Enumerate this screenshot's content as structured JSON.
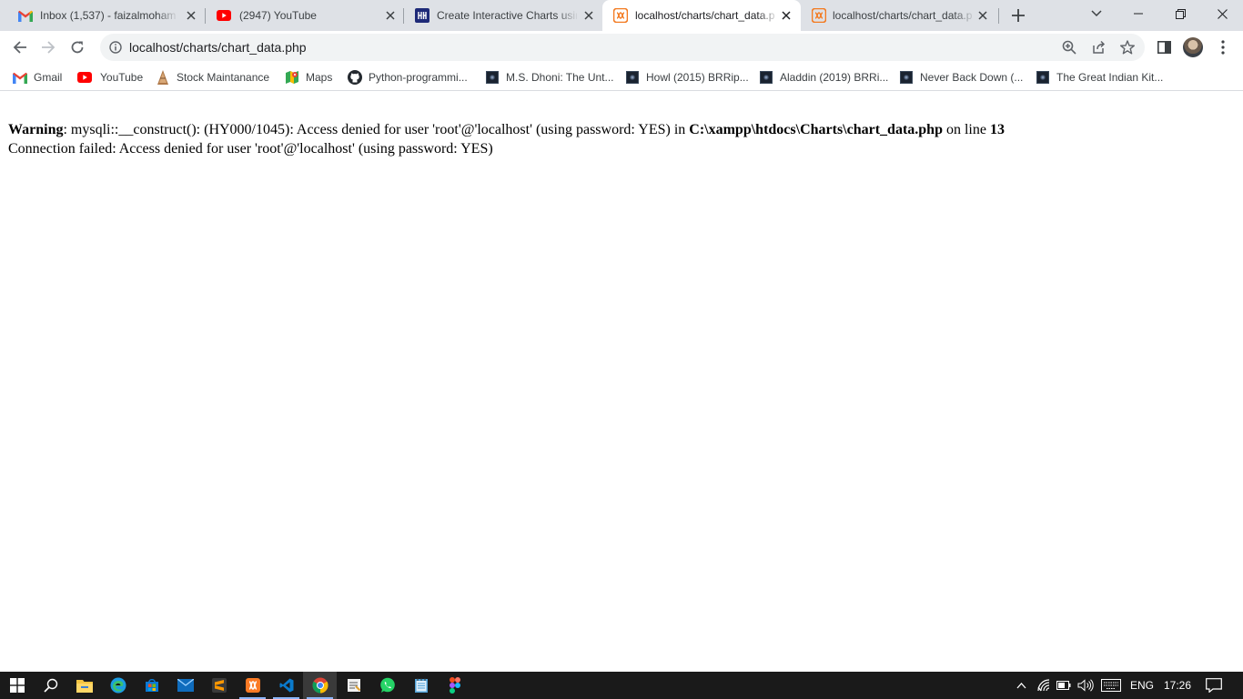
{
  "tabs": [
    {
      "title": "Inbox (1,537) - faizalmohamm",
      "icon": "gmail-icon",
      "active": false
    },
    {
      "title": "(2947) YouTube",
      "icon": "youtube-icon",
      "active": false
    },
    {
      "title": "Create Interactive Charts usin",
      "icon": "site-icon",
      "active": false
    },
    {
      "title": "localhost/charts/chart_data.p",
      "icon": "xampp-icon",
      "active": true
    },
    {
      "title": "localhost/charts/chart_data.p",
      "icon": "xampp-icon",
      "active": false
    }
  ],
  "address_bar": {
    "url": "localhost/charts/chart_data.php"
  },
  "bookmarks": [
    {
      "label": "Gmail",
      "icon": "gmail-icon"
    },
    {
      "label": "YouTube",
      "icon": "youtube-icon"
    },
    {
      "label": "Stock Maintanance",
      "icon": "stock-icon"
    },
    {
      "label": "Maps",
      "icon": "maps-icon"
    },
    {
      "label": "Python-programmi...",
      "icon": "github-icon"
    },
    {
      "label": "M.S. Dhoni: The Unt...",
      "icon": "film-icon"
    },
    {
      "label": "Howl (2015) BRRip...",
      "icon": "film-icon"
    },
    {
      "label": "Aladdin (2019) BRRi...",
      "icon": "film-icon"
    },
    {
      "label": "Never Back Down (...",
      "icon": "film-icon"
    },
    {
      "label": "The Great Indian Kit...",
      "icon": "film-icon"
    }
  ],
  "page": {
    "warning_label": "Warning",
    "warning_text": ": mysqli::__construct(): (HY000/1045): Access denied for user 'root'@'localhost' (using password: YES) in ",
    "warning_file": "C:\\xampp\\htdocs\\Charts\\chart_data.php",
    "warning_online": " on line ",
    "warning_line": "13",
    "connection_message": "Connection failed: Access denied for user 'root'@'localhost' (using password: YES)"
  },
  "taskbar": {
    "language": "ENG",
    "time": "17:26"
  }
}
